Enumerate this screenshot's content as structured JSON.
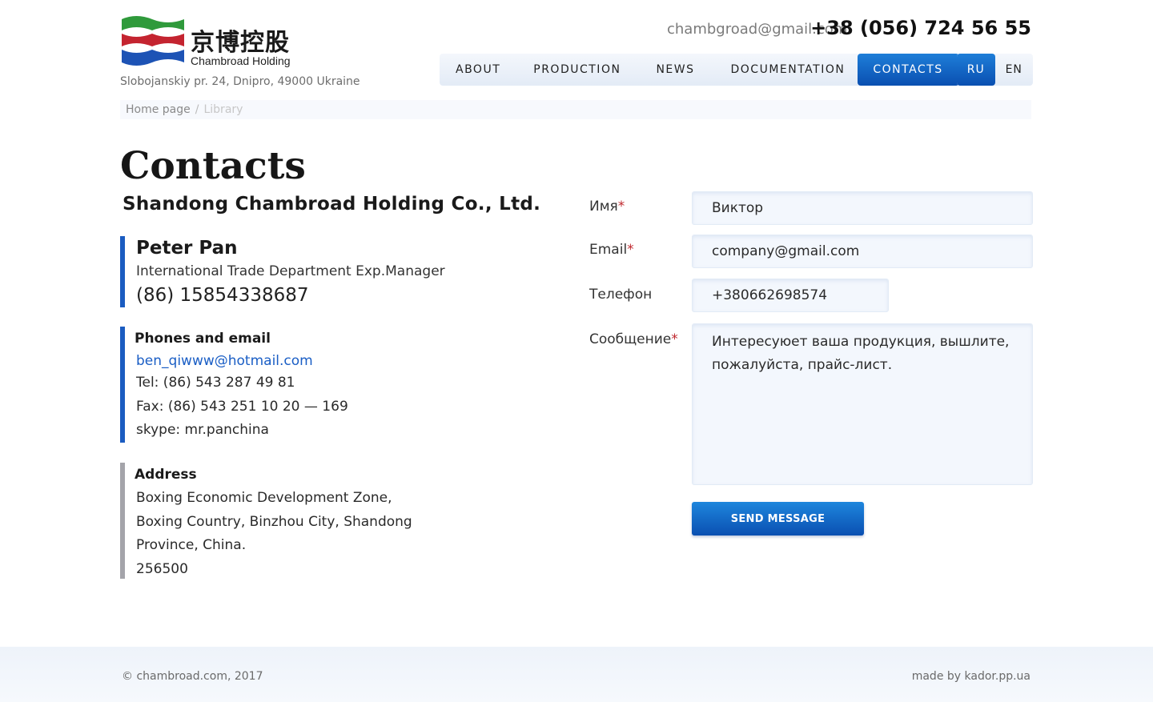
{
  "header": {
    "logo_cn": "京博控股",
    "logo_en": "Chambroad Holding",
    "address": "Slobojanskiy pr. 24, Dnipro, 49000 Ukraine",
    "email": "chambgroad@gmail.com",
    "phone": "+38 (056) 724 56 55"
  },
  "nav": {
    "items": [
      {
        "label": "ABOUT"
      },
      {
        "label": "PRODUCTION"
      },
      {
        "label": "NEWS"
      },
      {
        "label": "DOCUMENTATION"
      },
      {
        "label": "CONTACTS",
        "active": true
      }
    ]
  },
  "lang": {
    "items": [
      {
        "label": "RU",
        "active": true
      },
      {
        "label": "EN"
      }
    ]
  },
  "breadcrumb": {
    "home": "Home page",
    "separator": "/",
    "current": "Library"
  },
  "main": {
    "title": "Contacts",
    "company": "Shandong Chambroad Holding Co., Ltd.",
    "person": {
      "name": "Peter Pan",
      "role": "International Trade Department Exp.Manager",
      "phone": "(86) 15854338687"
    },
    "phones": {
      "heading": "Phones and email",
      "email": "ben_qiwww@hotmail.com",
      "tel": "Tel: (86) 543 287 49 81",
      "fax": "Fax: (86) 543 251 10 20 — 169",
      "skype": "skype: mr.panchina"
    },
    "address": {
      "heading": "Address",
      "lines": [
        "Boxing Economic Development Zone,",
        "Boxing Country, Binzhou City, Shandong",
        "Province, China.",
        "256500"
      ]
    }
  },
  "form": {
    "name_label": "Имя",
    "name_value": "Виктор",
    "email_label": "Email",
    "email_value": "company@gmail.com",
    "phone_label": "Телефон",
    "phone_value": "+380662698574",
    "message_label": "Сообщение",
    "message_value": "Интересуюет ваша продукция, вышлите, пожалуйста, прайс-лист.",
    "required_mark": "*",
    "submit_label": "SEND MESSAGE"
  },
  "footer": {
    "copyright": "© chambroad.com, 2017",
    "credit": "made by kador.pp.ua"
  },
  "colors": {
    "accent": "#0a4fb1",
    "accent_light": "#1e7ed8",
    "required": "#c0282e",
    "logo_green": "#2f9a3b",
    "logo_red": "#c42430",
    "logo_blue": "#1d53b5"
  }
}
